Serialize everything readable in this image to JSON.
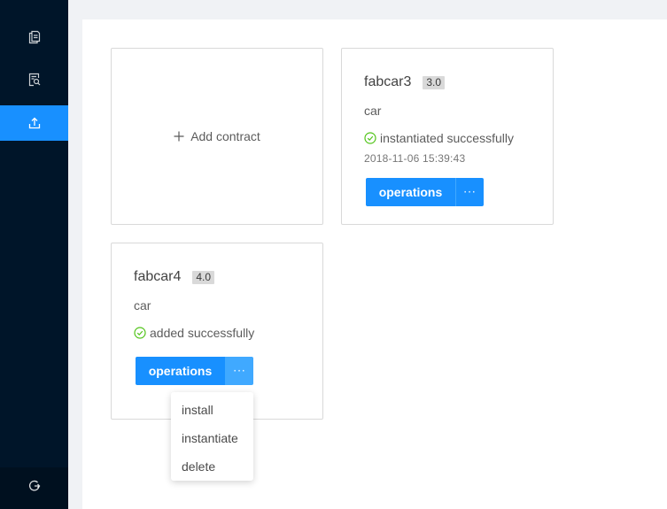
{
  "sidebar": {
    "items": [
      {
        "icon": "copy-icon"
      },
      {
        "icon": "file-search-icon"
      },
      {
        "icon": "upload-icon",
        "active": true
      }
    ],
    "bottom_icon": "logout-icon"
  },
  "add_card": {
    "label": "Add contract",
    "icon": "plus-icon"
  },
  "contracts": [
    {
      "name": "fabcar3",
      "version": "3.0",
      "description": "car",
      "status": "instantiated successfully",
      "timestamp": "2018-11-06 15:39:43",
      "operations_label": "operations",
      "more_label": "···"
    },
    {
      "name": "fabcar4",
      "version": "4.0",
      "description": "car",
      "status": "added successfully",
      "operations_label": "operations",
      "more_label": "···"
    }
  ],
  "dropdown": {
    "items": [
      "install",
      "instantiate",
      "delete"
    ]
  },
  "colors": {
    "sidebar_bg": "#001529",
    "primary": "#1890ff",
    "success": "#52c41a"
  }
}
